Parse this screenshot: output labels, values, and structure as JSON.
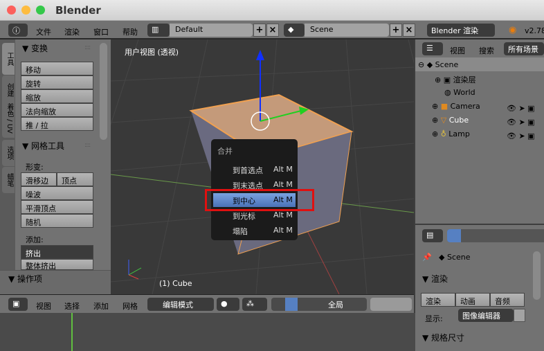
{
  "window": {
    "title": "Blender"
  },
  "topbar": {
    "menus": [
      "文件",
      "渲染",
      "窗口",
      "帮助"
    ],
    "layout": "Default",
    "scene": "Scene",
    "engine": "Blender 渲染",
    "version": "v2.78"
  },
  "toolshelf": {
    "tabs": [
      "工具",
      "创建",
      "着色 / UV",
      "选项",
      "蜡笔"
    ],
    "transform": {
      "title": "变换",
      "buttons": [
        "移动",
        "旋转",
        "缩放",
        "法向缩放",
        "推 / 拉"
      ]
    },
    "mesh_tools": {
      "title": "网格工具",
      "deform_label": "形变:",
      "slide_edge": "滑移边",
      "vertex": "顶点",
      "buttons": [
        "噪波",
        "平滑顶点",
        "随机"
      ],
      "add_label": "添加:",
      "extrude": "挤出",
      "extrude_all": "整体挤出"
    },
    "operator": {
      "title": "操作项"
    }
  },
  "viewport": {
    "label": "用户视图 (透视)",
    "object_label": "(1) Cube"
  },
  "merge_menu": {
    "title": "合并",
    "items": [
      {
        "label": "到首选点",
        "shortcut": "Alt M"
      },
      {
        "label": "到末选点",
        "shortcut": "Alt M"
      },
      {
        "label": "到中心",
        "shortcut": "Alt M",
        "highlighted": true
      },
      {
        "label": "到光标",
        "shortcut": "Alt M"
      },
      {
        "label": "塌陷",
        "shortcut": "Alt M"
      }
    ]
  },
  "view3d_header": {
    "menus": [
      "视图",
      "选择",
      "添加",
      "网格"
    ],
    "mode": "编辑模式",
    "orientation": "全局"
  },
  "outliner": {
    "menus": [
      "视图",
      "搜索"
    ],
    "filter": "所有场景",
    "items": [
      "Scene",
      "渲染层",
      "World",
      "Camera",
      "Cube",
      "Lamp"
    ]
  },
  "properties": {
    "scene": "Scene",
    "render_title": "渲染",
    "buttons": [
      "渲染",
      "动画",
      "音频"
    ],
    "display_label": "显示:",
    "display_value": "图像编辑器",
    "dimensions_title": "规格尺寸"
  },
  "colors": {
    "highlight": "#5680c2",
    "selection_box": "#e01010",
    "cube_selected": "#f0a050"
  }
}
